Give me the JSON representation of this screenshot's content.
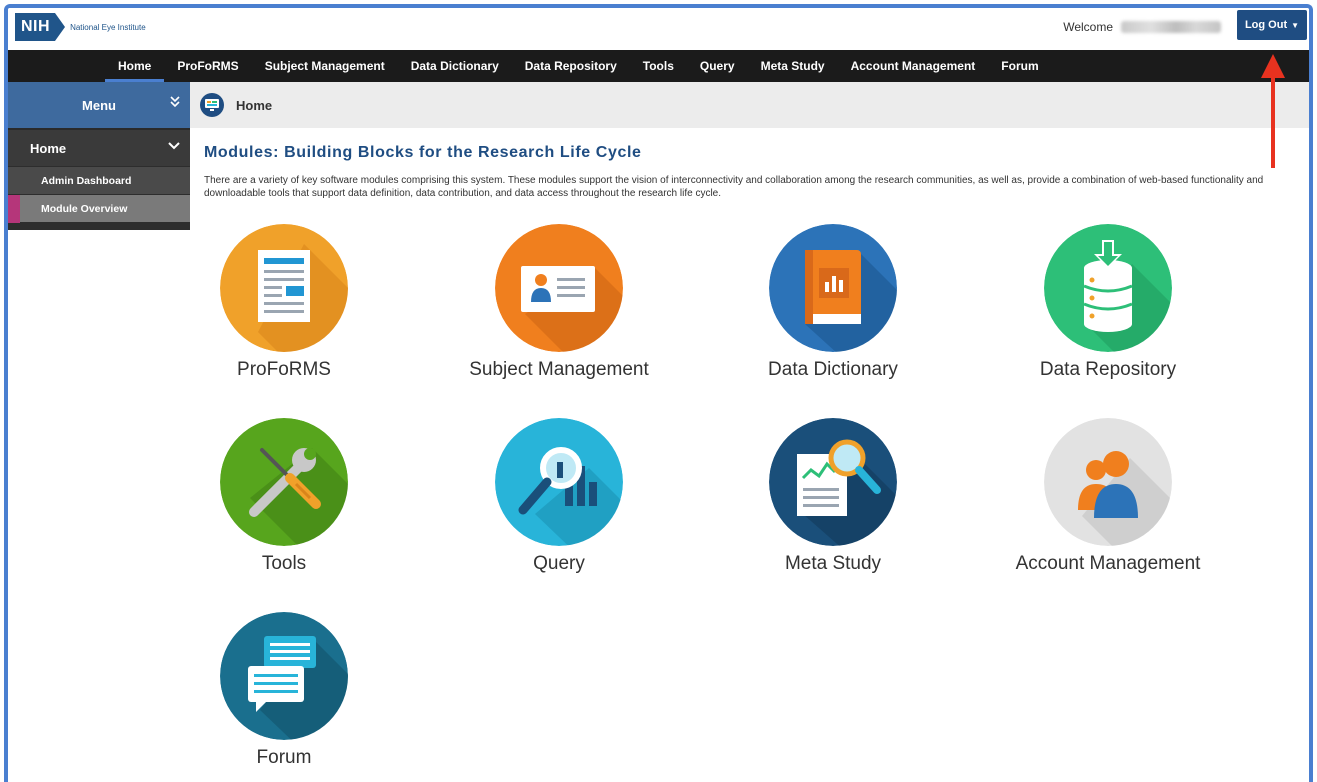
{
  "header": {
    "logo_mark": "NIH",
    "logo_text": "National Eye Institute",
    "welcome_label": "Welcome",
    "logout_label": "Log Out"
  },
  "nav": {
    "items": [
      "Home",
      "ProFoRMS",
      "Subject Management",
      "Data Dictionary",
      "Data Repository",
      "Tools",
      "Query",
      "Meta Study",
      "Account Management",
      "Forum"
    ],
    "active": "Home"
  },
  "sidebar": {
    "menu_label": "Menu",
    "home_label": "Home",
    "sub_items": [
      "Admin Dashboard",
      "Module Overview"
    ],
    "active_sub": "Module Overview"
  },
  "breadcrumb": {
    "label": "Home"
  },
  "main": {
    "title": "Modules: Building Blocks for the Research Life Cycle",
    "description": "There are a variety of key software modules comprising this system. These modules support the vision of interconnectivity and collaboration among the research communities, as well as, provide a combination of web-based functionality and downloadable tools that support data definition, data contribution, and data access throughout the research life cycle."
  },
  "modules": [
    {
      "label": "ProFoRMS",
      "icon": "document-icon",
      "color": "#f0a12a"
    },
    {
      "label": "Subject Management",
      "icon": "id-card-icon",
      "color": "#f07f1e"
    },
    {
      "label": "Data Dictionary",
      "icon": "book-chart-icon",
      "color": "#2c73b8"
    },
    {
      "label": "Data Repository",
      "icon": "database-download-icon",
      "color": "#2dbf78"
    },
    {
      "label": "Tools",
      "icon": "wrench-screwdriver-icon",
      "color": "#57a51d"
    },
    {
      "label": "Query",
      "icon": "magnifier-chart-icon",
      "color": "#28b4d9"
    },
    {
      "label": "Meta Study",
      "icon": "report-magnifier-icon",
      "color": "#1a4f7a"
    },
    {
      "label": "Account Management",
      "icon": "users-icon",
      "color": "#e2e2e2"
    },
    {
      "label": "Forum",
      "icon": "chat-bubbles-icon",
      "color": "#1a6f8e"
    }
  ],
  "colors": {
    "brand_blue": "#1f4d82",
    "nav_bg": "#1b1b1b",
    "annotation_arrow": "#e8321f"
  }
}
